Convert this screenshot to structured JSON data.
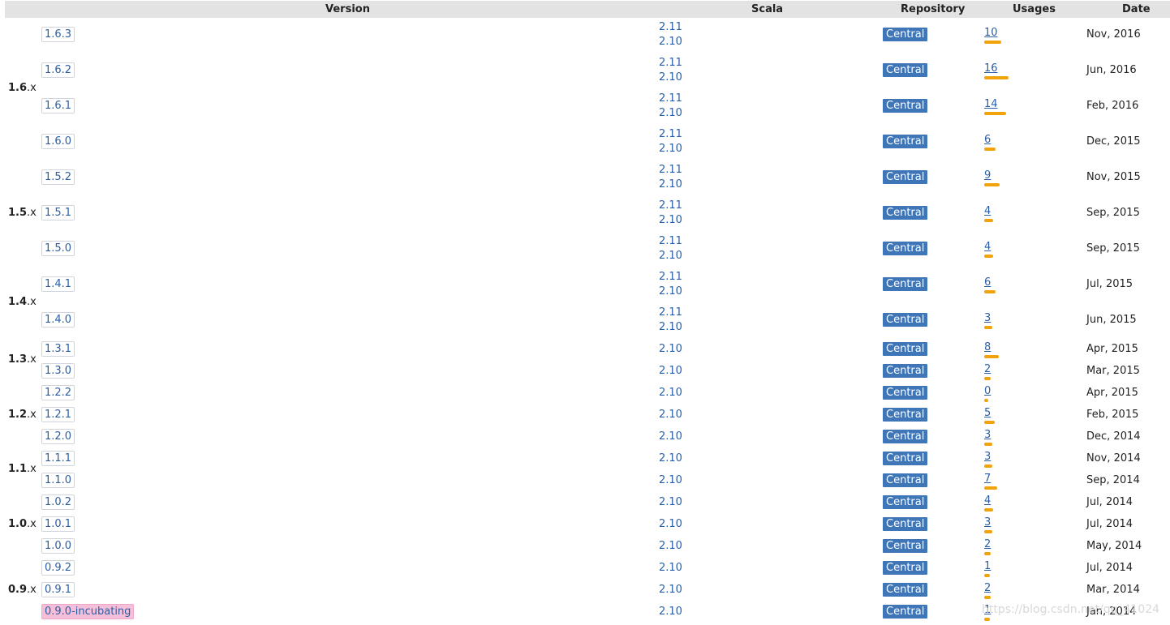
{
  "headers": {
    "version": "Version",
    "scala": "Scala",
    "repository": "Repository",
    "usages": "Usages",
    "date": "Date"
  },
  "groups": [
    {
      "major": "1.6",
      "suffix": ".x"
    },
    {
      "major": "1.5",
      "suffix": ".x"
    },
    {
      "major": "1.4",
      "suffix": ".x"
    },
    {
      "major": "1.3",
      "suffix": ".x"
    },
    {
      "major": "1.2",
      "suffix": ".x"
    },
    {
      "major": "1.1",
      "suffix": ".x"
    },
    {
      "major": "1.0",
      "suffix": ".x"
    },
    {
      "major": "0.9",
      "suffix": ".x"
    }
  ],
  "rows": [
    {
      "version": "1.6.3",
      "scala": [
        "2.11",
        "2.10"
      ],
      "repo": "Central",
      "usages": "10",
      "date": "Nov, 2016"
    },
    {
      "version": "1.6.2",
      "scala": [
        "2.11",
        "2.10"
      ],
      "repo": "Central",
      "usages": "16",
      "date": "Jun, 2016"
    },
    {
      "version": "1.6.1",
      "scala": [
        "2.11",
        "2.10"
      ],
      "repo": "Central",
      "usages": "14",
      "date": "Feb, 2016"
    },
    {
      "version": "1.6.0",
      "scala": [
        "2.11",
        "2.10"
      ],
      "repo": "Central",
      "usages": "6",
      "date": "Dec, 2015"
    },
    {
      "version": "1.5.2",
      "scala": [
        "2.11",
        "2.10"
      ],
      "repo": "Central",
      "usages": "9",
      "date": "Nov, 2015"
    },
    {
      "version": "1.5.1",
      "scala": [
        "2.11",
        "2.10"
      ],
      "repo": "Central",
      "usages": "4",
      "date": "Sep, 2015"
    },
    {
      "version": "1.5.0",
      "scala": [
        "2.11",
        "2.10"
      ],
      "repo": "Central",
      "usages": "4",
      "date": "Sep, 2015"
    },
    {
      "version": "1.4.1",
      "scala": [
        "2.11",
        "2.10"
      ],
      "repo": "Central",
      "usages": "6",
      "date": "Jul, 2015"
    },
    {
      "version": "1.4.0",
      "scala": [
        "2.11",
        "2.10"
      ],
      "repo": "Central",
      "usages": "3",
      "date": "Jun, 2015"
    },
    {
      "version": "1.3.1",
      "scala": [
        "2.10"
      ],
      "repo": "Central",
      "usages": "8",
      "date": "Apr, 2015"
    },
    {
      "version": "1.3.0",
      "scala": [
        "2.10"
      ],
      "repo": "Central",
      "usages": "2",
      "date": "Mar, 2015"
    },
    {
      "version": "1.2.2",
      "scala": [
        "2.10"
      ],
      "repo": "Central",
      "usages": "0",
      "date": "Apr, 2015"
    },
    {
      "version": "1.2.1",
      "scala": [
        "2.10"
      ],
      "repo": "Central",
      "usages": "5",
      "date": "Feb, 2015"
    },
    {
      "version": "1.2.0",
      "scala": [
        "2.10"
      ],
      "repo": "Central",
      "usages": "3",
      "date": "Dec, 2014"
    },
    {
      "version": "1.1.1",
      "scala": [
        "2.10"
      ],
      "repo": "Central",
      "usages": "3",
      "date": "Nov, 2014"
    },
    {
      "version": "1.1.0",
      "scala": [
        "2.10"
      ],
      "repo": "Central",
      "usages": "7",
      "date": "Sep, 2014"
    },
    {
      "version": "1.0.2",
      "scala": [
        "2.10"
      ],
      "repo": "Central",
      "usages": "4",
      "date": "Jul, 2014"
    },
    {
      "version": "1.0.1",
      "scala": [
        "2.10"
      ],
      "repo": "Central",
      "usages": "3",
      "date": "Jul, 2014"
    },
    {
      "version": "1.0.0",
      "scala": [
        "2.10"
      ],
      "repo": "Central",
      "usages": "2",
      "date": "May, 2014"
    },
    {
      "version": "0.9.2",
      "scala": [
        "2.10"
      ],
      "repo": "Central",
      "usages": "1",
      "date": "Jul, 2014"
    },
    {
      "version": "0.9.1",
      "scala": [
        "2.10"
      ],
      "repo": "Central",
      "usages": "2",
      "date": "Mar, 2014"
    },
    {
      "version": "0.9.0-incubating",
      "scala": [
        "2.10"
      ],
      "repo": "Central",
      "usages": "1",
      "date": "Jan, 2014"
    }
  ],
  "watermark": "https://blog.csdn.net/qq_41024",
  "colors": {
    "header_bg": "#e3e3e3",
    "link": "#2a5ea6",
    "repo_badge": "#3f76b8",
    "usage_bar": "#f0a30a",
    "incubating_bg": "#f6bfd9"
  }
}
